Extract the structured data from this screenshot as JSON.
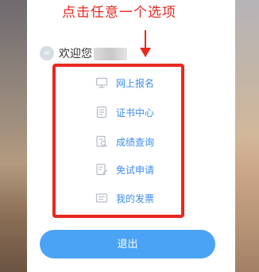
{
  "annotation": {
    "title": "点击任意一个选项"
  },
  "user": {
    "avatar_text": "Hi",
    "welcome": "欢迎您"
  },
  "menu": {
    "items": [
      {
        "label": "网上报名",
        "icon": "monitor-icon"
      },
      {
        "label": "证书中心",
        "icon": "certificate-icon"
      },
      {
        "label": "成绩查询",
        "icon": "score-search-icon"
      },
      {
        "label": "免试申请",
        "icon": "application-form-icon"
      },
      {
        "label": "我的发票",
        "icon": "invoice-icon"
      }
    ]
  },
  "logout": {
    "label": "退出"
  },
  "colors": {
    "annotation_red": "#e8281f",
    "link_blue": "#3e8cf1",
    "button_blue": "#4aa3f5"
  }
}
